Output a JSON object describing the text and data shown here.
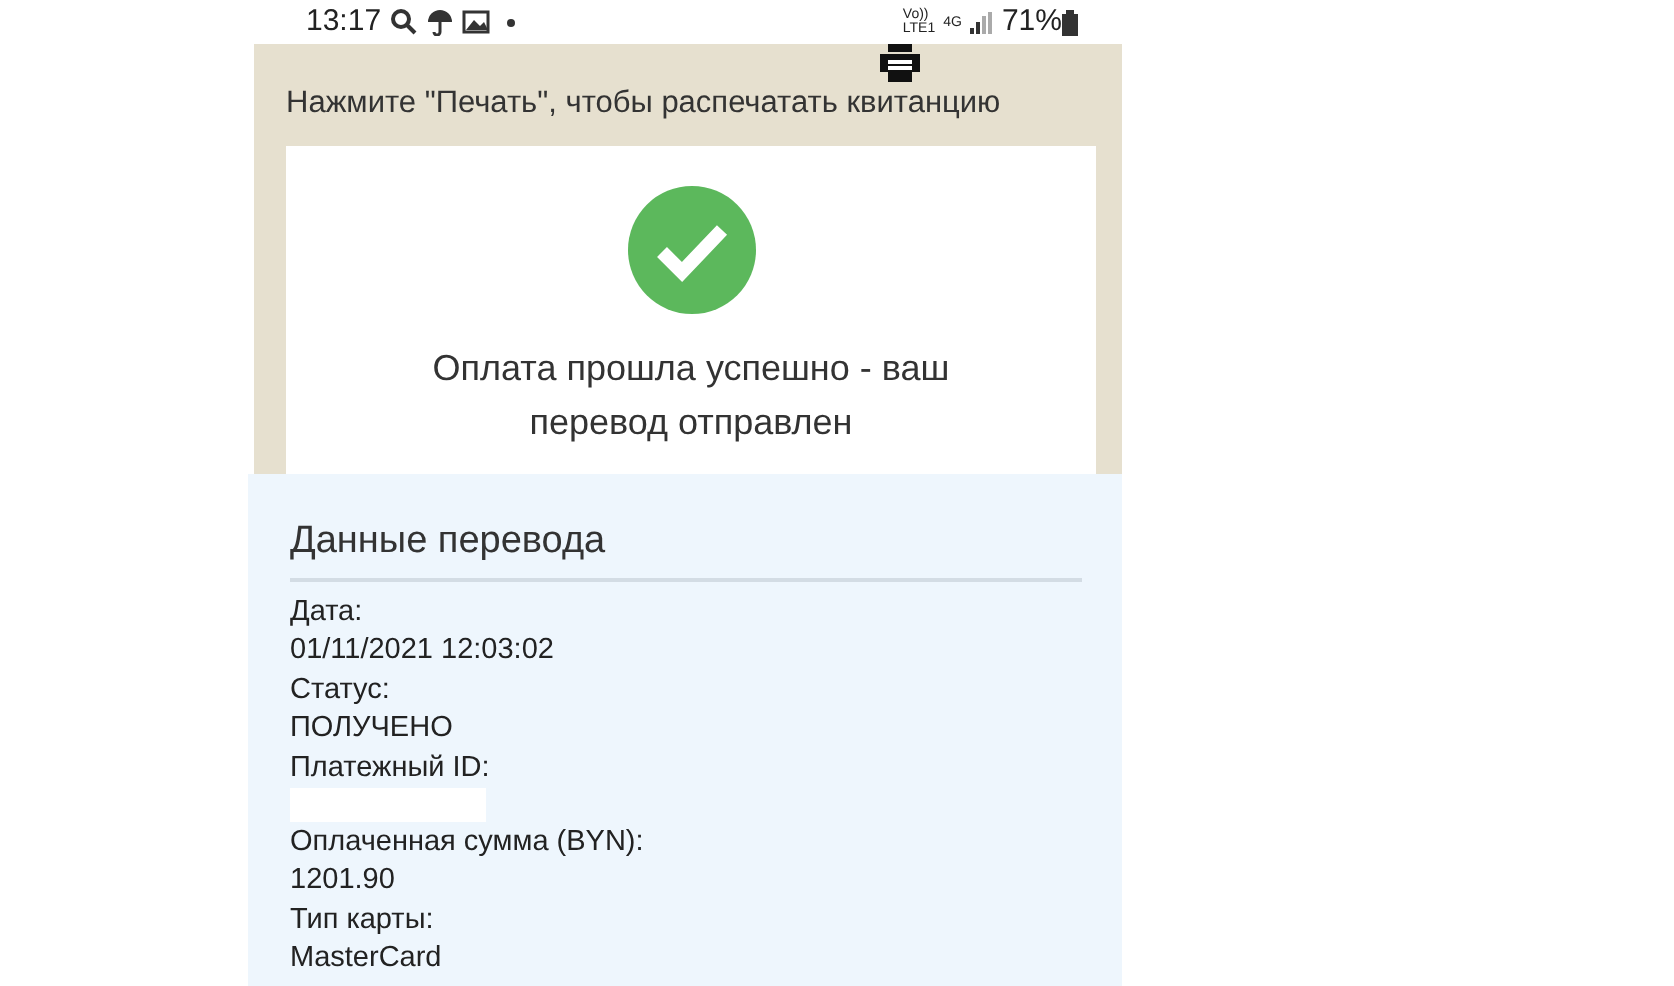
{
  "status_bar": {
    "time": "13:17",
    "volte_top": "Vo))",
    "volte_bottom": "LTE1",
    "network": "4G",
    "battery": "71%"
  },
  "header": {
    "hint": "Нажмите \"Печать\", чтобы распечатать квитанцию"
  },
  "result": {
    "message": "Оплата прошла успешно - ваш перевод отправлен"
  },
  "details": {
    "title": "Данные перевода",
    "fields": [
      {
        "label": "Дата:",
        "value": "01/11/2021 12:03:02"
      },
      {
        "label": "Статус:",
        "value": "ПОЛУЧЕНО"
      },
      {
        "label": "Платежный ID:"
      },
      {
        "label": "Оплаченная сумма (BYN):",
        "value": "1201.90"
      },
      {
        "label": "Тип карты:",
        "value": "MasterCard"
      }
    ]
  }
}
